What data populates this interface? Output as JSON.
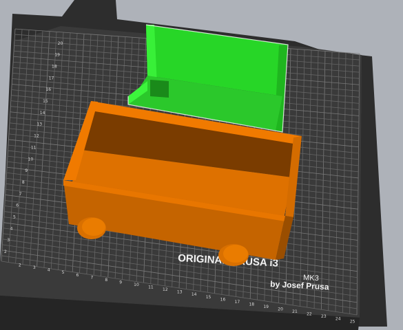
{
  "bed": {
    "brand_line1": "ORIGINAL PRUSA i3",
    "brand_model": "MK3",
    "brand_line2": "by Josef Prusa",
    "x_axis_labels": [
      "2",
      "3",
      "4",
      "5",
      "6",
      "7",
      "8",
      "9",
      "10",
      "11",
      "12",
      "13",
      "14",
      "15",
      "16",
      "17",
      "18",
      "19",
      "20",
      "21",
      "22",
      "23",
      "24",
      "25"
    ],
    "y_axis_labels": [
      "2",
      "3",
      "4",
      "5",
      "6",
      "7",
      "8",
      "9",
      "10",
      "11",
      "12",
      "13",
      "14",
      "15",
      "16",
      "17",
      "18",
      "19",
      "20"
    ]
  },
  "objects": [
    {
      "name": "green-box-object",
      "color": "#22dd22",
      "selected": true
    },
    {
      "name": "orange-cart-object",
      "color": "#e07000",
      "selected": false
    }
  ],
  "colors": {
    "background": "#aeb2b9",
    "bed_surface": "#3b3b3b",
    "bed_frame": "#2a2a2a",
    "grid_line": "#6a6a6a",
    "orange_top": "#e07000",
    "orange_front": "#c86400",
    "orange_inner": "#7a3c00",
    "green_light": "#33ee33",
    "green_dark": "#1aa81a"
  }
}
